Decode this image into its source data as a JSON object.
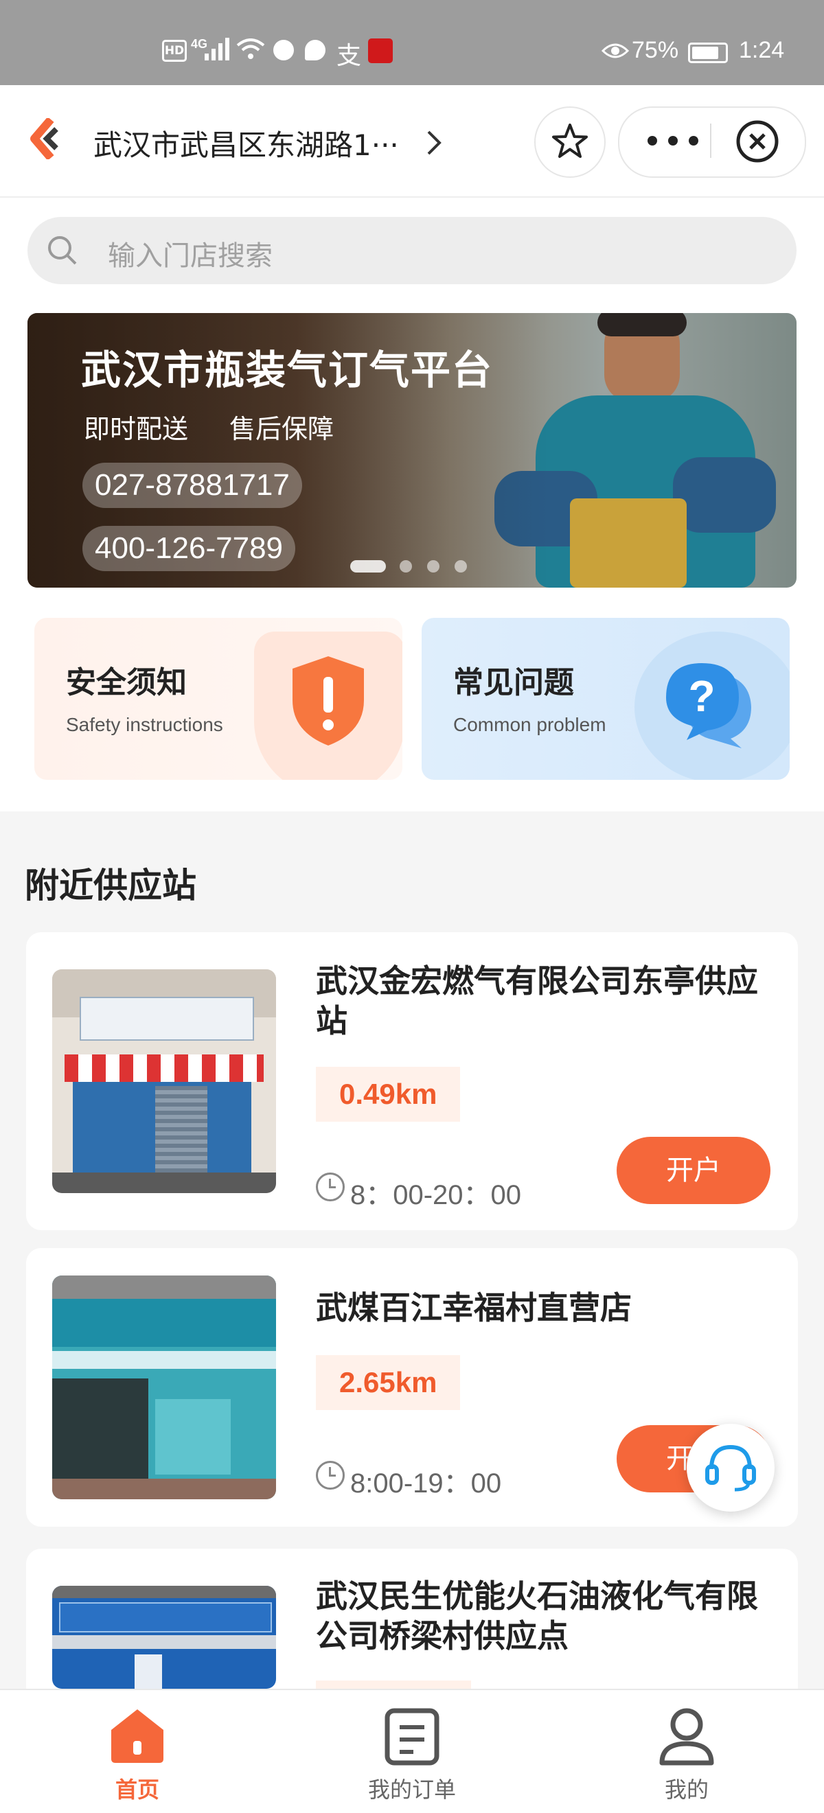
{
  "status_bar": {
    "hd": "HD",
    "network": "4G",
    "battery": "75%",
    "time": "1:24",
    "icons": [
      "hd-icon",
      "signal-icon",
      "wifi-icon",
      "notification-icon",
      "chat-icon",
      "alipay-icon",
      "app-icon",
      "eye-icon",
      "battery-icon"
    ]
  },
  "header": {
    "location": "武汉市武昌区东湖路1···",
    "icons": [
      "logo-icon",
      "chevron-right-icon",
      "star-icon",
      "more-icon",
      "close-icon"
    ]
  },
  "search": {
    "placeholder": "输入门店搜索"
  },
  "banner": {
    "title": "武汉市瓶装气订气平台",
    "subtitle_1": "即时配送",
    "subtitle_2": "售后保障",
    "phone_1": "027-87881717",
    "phone_2": "400-126-7789",
    "slide_count": 4,
    "active_slide": 1
  },
  "quick_cards": [
    {
      "title": "安全须知",
      "subtitle": "Safety instructions",
      "icon": "shield-alert-icon"
    },
    {
      "title": "常见问题",
      "subtitle": "Common problem",
      "icon": "question-chat-icon"
    }
  ],
  "nearby": {
    "section_title": "附近供应站",
    "stores": [
      {
        "name": "武汉金宏燃气有限公司东亭供应站",
        "distance": "0.49km",
        "hours": "8：00-20：00",
        "action": "开户"
      },
      {
        "name": "武煤百江幸福村直营店",
        "distance": "2.65km",
        "hours": "8:00-19：00",
        "action": "开户"
      },
      {
        "name": "武汉民生优能火石油液化气有限公司桥梁村供应点",
        "distance": "",
        "hours": "",
        "action": ""
      }
    ]
  },
  "customer_service": {
    "icon": "headset-icon"
  },
  "tabbar": {
    "tabs": [
      {
        "label": "首页",
        "icon": "home-icon",
        "active": true
      },
      {
        "label": "我的订单",
        "icon": "order-icon",
        "active": false
      },
      {
        "label": "我的",
        "icon": "user-icon",
        "active": false
      }
    ]
  },
  "colors": {
    "accent": "#f5673a",
    "status_bar": "#9d9d9d",
    "faq_blue": "#2f8fe6"
  }
}
